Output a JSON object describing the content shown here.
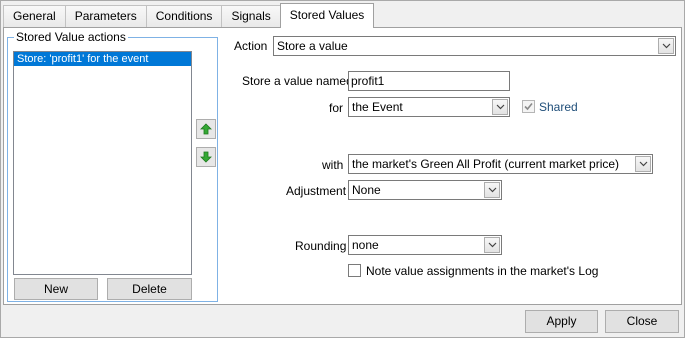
{
  "tabs": [
    "General",
    "Parameters",
    "Conditions",
    "Signals",
    "Stored Values"
  ],
  "active_tab": "Stored Values",
  "stored_values": {
    "group_title": "Stored Value actions",
    "items": [
      "Store: 'profit1' for the event"
    ],
    "new_label": "New",
    "delete_label": "Delete"
  },
  "form": {
    "action_label": "Action",
    "action_value": "Store a value",
    "name_label": "Store a value named",
    "name_value": "profit1",
    "for_label": "for",
    "for_value": "the Event",
    "shared_label": "Shared",
    "shared_checked": true,
    "with_label": "with",
    "with_value": "the market's Green All Profit (current market price)",
    "adjustment_label": "Adjustment",
    "adjustment_value": "None",
    "rounding_label": "Rounding",
    "rounding_value": "none",
    "log_label": "Note value assignments in the market's Log",
    "log_checked": false
  },
  "footer": {
    "apply_label": "Apply",
    "close_label": "Close"
  },
  "colors": {
    "selection": "#0078d7",
    "group_border": "#7fb2e5",
    "arrow_green": "#2e9e2e"
  }
}
